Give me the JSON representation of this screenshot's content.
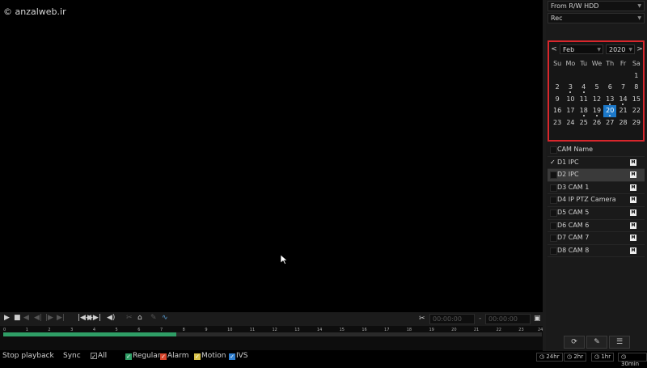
{
  "watermark": "anzalweb.ir",
  "source_select": {
    "value": "From R/W HDD"
  },
  "type_select": {
    "value": "Rec"
  },
  "calendar": {
    "prev": "<",
    "next": ">",
    "month": "Feb",
    "year": "2020",
    "weekdays": [
      "Su",
      "Mo",
      "Tu",
      "We",
      "Th",
      "Fr",
      "Sa"
    ],
    "weeks": [
      [
        "",
        "",
        "",
        "",
        "",
        "",
        "1"
      ],
      [
        "2",
        "3",
        "4",
        "5",
        "6",
        "7",
        "8"
      ],
      [
        "9",
        "10",
        "11",
        "12",
        "13",
        "14",
        "15"
      ],
      [
        "16",
        "17",
        "18",
        "19",
        "20",
        "21",
        "22"
      ],
      [
        "23",
        "24",
        "25",
        "26",
        "27",
        "28",
        "29"
      ]
    ],
    "selected_day": "20",
    "recorded_days": [
      "3",
      "4",
      "13",
      "14",
      "18",
      "19",
      "20"
    ]
  },
  "cam_list": {
    "header": "CAM Name",
    "cams": [
      {
        "name": "D1 IPC",
        "checked": true,
        "highlight": false,
        "m": "M"
      },
      {
        "name": "D2 IPC",
        "checked": false,
        "highlight": true,
        "m": "M"
      },
      {
        "name": "D3 CAM 1",
        "checked": false,
        "highlight": false,
        "m": "M"
      },
      {
        "name": "D4 IP PTZ Camera",
        "checked": false,
        "highlight": false,
        "m": "M"
      },
      {
        "name": "D5 CAM 5",
        "checked": false,
        "highlight": false,
        "m": "M"
      },
      {
        "name": "D6 CAM 6",
        "checked": false,
        "highlight": false,
        "m": "M"
      },
      {
        "name": "D7 CAM 7",
        "checked": false,
        "highlight": false,
        "m": "M"
      },
      {
        "name": "D8 CAM 8",
        "checked": false,
        "highlight": false,
        "m": "M"
      }
    ]
  },
  "time_segment": {
    "start": "00:00:00",
    "separator": "-",
    "end": "00:00:00"
  },
  "timeline": {
    "hours": [
      "0",
      "1",
      "2",
      "3",
      "4",
      "5",
      "6",
      "7",
      "8",
      "9",
      "10",
      "11",
      "12",
      "13",
      "14",
      "15",
      "16",
      "17",
      "18",
      "19",
      "20",
      "21",
      "22",
      "23",
      "24"
    ],
    "recorded_until_hour": 7.7
  },
  "status": {
    "state": "Stop playback",
    "sync": "Sync",
    "all": "All",
    "legend": [
      {
        "label": "Regular",
        "color": "#2f9e66"
      },
      {
        "label": "Alarm",
        "color": "#d8462c"
      },
      {
        "label": "Motion",
        "color": "#d9c34a"
      },
      {
        "label": "IVS",
        "color": "#2f7fd0"
      }
    ],
    "zoom": [
      "24hr",
      "2hr",
      "1hr",
      "30min"
    ]
  }
}
